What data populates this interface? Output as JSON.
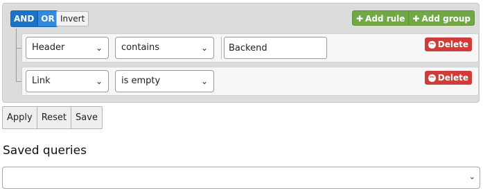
{
  "builder": {
    "condition_buttons": [
      "AND",
      "OR"
    ],
    "invert_label": "Invert",
    "add_rule_label": "Add rule",
    "add_group_label": "Add group",
    "rules": [
      {
        "field": "Header",
        "operator": "contains",
        "value": "Backend",
        "delete_label": "Delete"
      },
      {
        "field": "Link",
        "operator": "is empty",
        "delete_label": "Delete"
      }
    ]
  },
  "actions": {
    "apply_label": "Apply",
    "reset_label": "Reset",
    "save_label": "Save"
  },
  "saved_queries": {
    "title": "Saved queries",
    "selected": ""
  },
  "colors": {
    "and_or": "#1a73c9",
    "add": "#6fa844",
    "delete": "#d13b35"
  }
}
